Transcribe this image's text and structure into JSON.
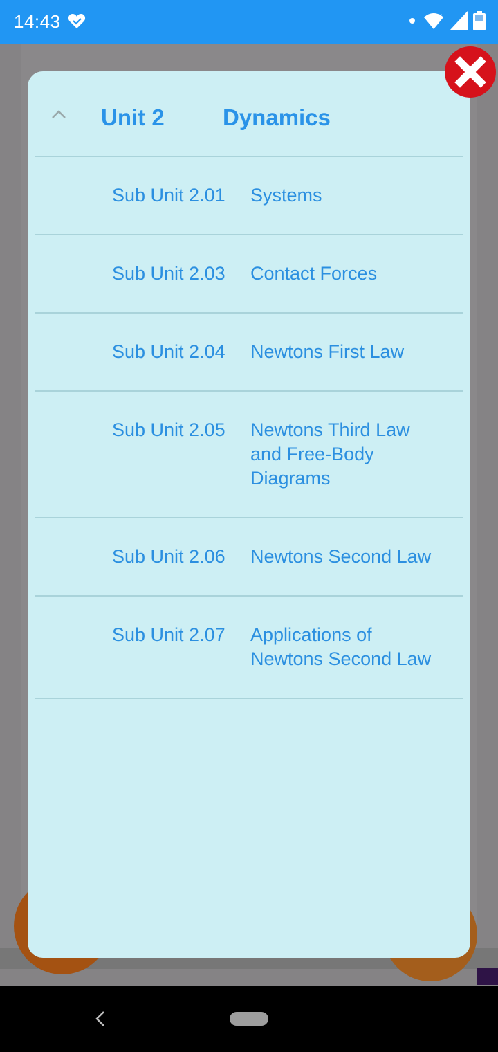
{
  "status_bar": {
    "time": "14:43",
    "icons": [
      "heart-check-icon",
      "notification-dot-icon",
      "wifi-icon",
      "signal-icon",
      "battery-icon"
    ]
  },
  "modal": {
    "unit_label": "Unit 2",
    "unit_title": "Dynamics",
    "collapse_icon": "chevron-up-icon",
    "sub_units": [
      {
        "code": "Sub Unit 2.01",
        "name": "Systems"
      },
      {
        "code": "Sub Unit 2.03",
        "name": "Contact Forces"
      },
      {
        "code": "Sub Unit 2.04",
        "name": "Newtons First Law"
      },
      {
        "code": "Sub Unit 2.05",
        "name": "Newtons Third Law and Free-Body Diagrams"
      },
      {
        "code": "Sub Unit 2.06",
        "name": "Newtons Second Law"
      },
      {
        "code": "Sub Unit 2.07",
        "name": "Applications of Newtons Second Law"
      }
    ]
  },
  "close_button": {
    "icon": "close-icon"
  },
  "nav_bar": {
    "back_icon": "back-icon",
    "home_icon": "home-pill-icon"
  },
  "colors": {
    "status_bar": "#2196f3",
    "modal_bg": "#cdeff4",
    "accent_text": "#2a93e8",
    "close_red": "#d6121b"
  }
}
